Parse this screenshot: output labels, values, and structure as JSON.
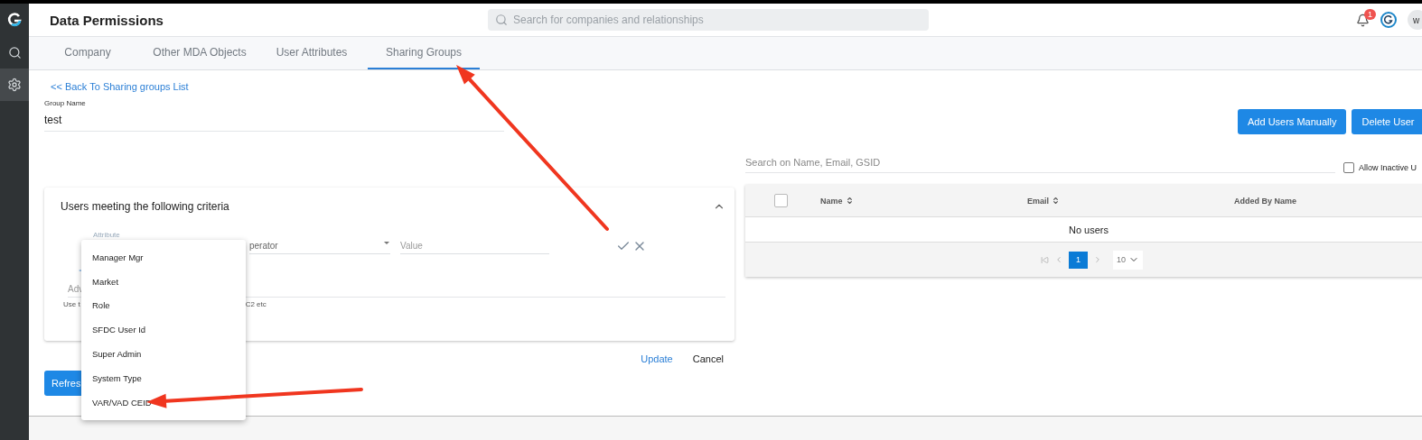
{
  "sidebar": {
    "items": [
      {
        "kind": "logo",
        "selected": false
      },
      {
        "kind": "search",
        "selected": false
      },
      {
        "kind": "settings",
        "selected": true
      }
    ]
  },
  "header": {
    "title": "Data Permissions",
    "search": {
      "placeholder": "Search for companies and relationships"
    },
    "notification_badge": "1",
    "avatar": "w"
  },
  "tabs": [
    {
      "label": "Company",
      "selected": false
    },
    {
      "label": "Other MDA Objects",
      "selected": false
    },
    {
      "label": "User Attributes",
      "selected": false
    },
    {
      "label": "Sharing Groups",
      "selected": true
    }
  ],
  "back_link": "<< Back To Sharing groups List",
  "group_name": {
    "label": "Group Name",
    "value": "test"
  },
  "criteria": {
    "title": "Users meeting the following criteria",
    "expanded": true,
    "attribute_label": "Attribute",
    "operator": "perator",
    "value_placeholder": "Value",
    "advanced": "Adv",
    "hint_start": "Use t",
    "hint_end": "C2 etc"
  },
  "update": "Update",
  "cancel": "Cancel",
  "refresh": "Refres",
  "dropdown": {
    "items": [
      "Manager Mgr",
      "Market",
      "Role",
      "SFDC User Id",
      "Super Admin",
      "System Type",
      "VAR/VAD CEID"
    ]
  },
  "users": {
    "buttons": [
      "Add Users Manually",
      "Delete User"
    ],
    "search": {
      "placeholder": "Search on Name, Email, GSID"
    },
    "allow_inactive": {
      "label": "Allow Inactive U",
      "checked": false
    },
    "columns": [
      {
        "label": "Name",
        "sortable": true
      },
      {
        "label": "Email",
        "sortable": true
      },
      {
        "label": "Added By Name",
        "sortable": false
      }
    ],
    "select_all": false,
    "empty": "No users",
    "page": "1",
    "page_size": "10"
  },
  "annotations": [
    {
      "kind": "arrow"
    },
    {
      "kind": "arrow"
    }
  ]
}
